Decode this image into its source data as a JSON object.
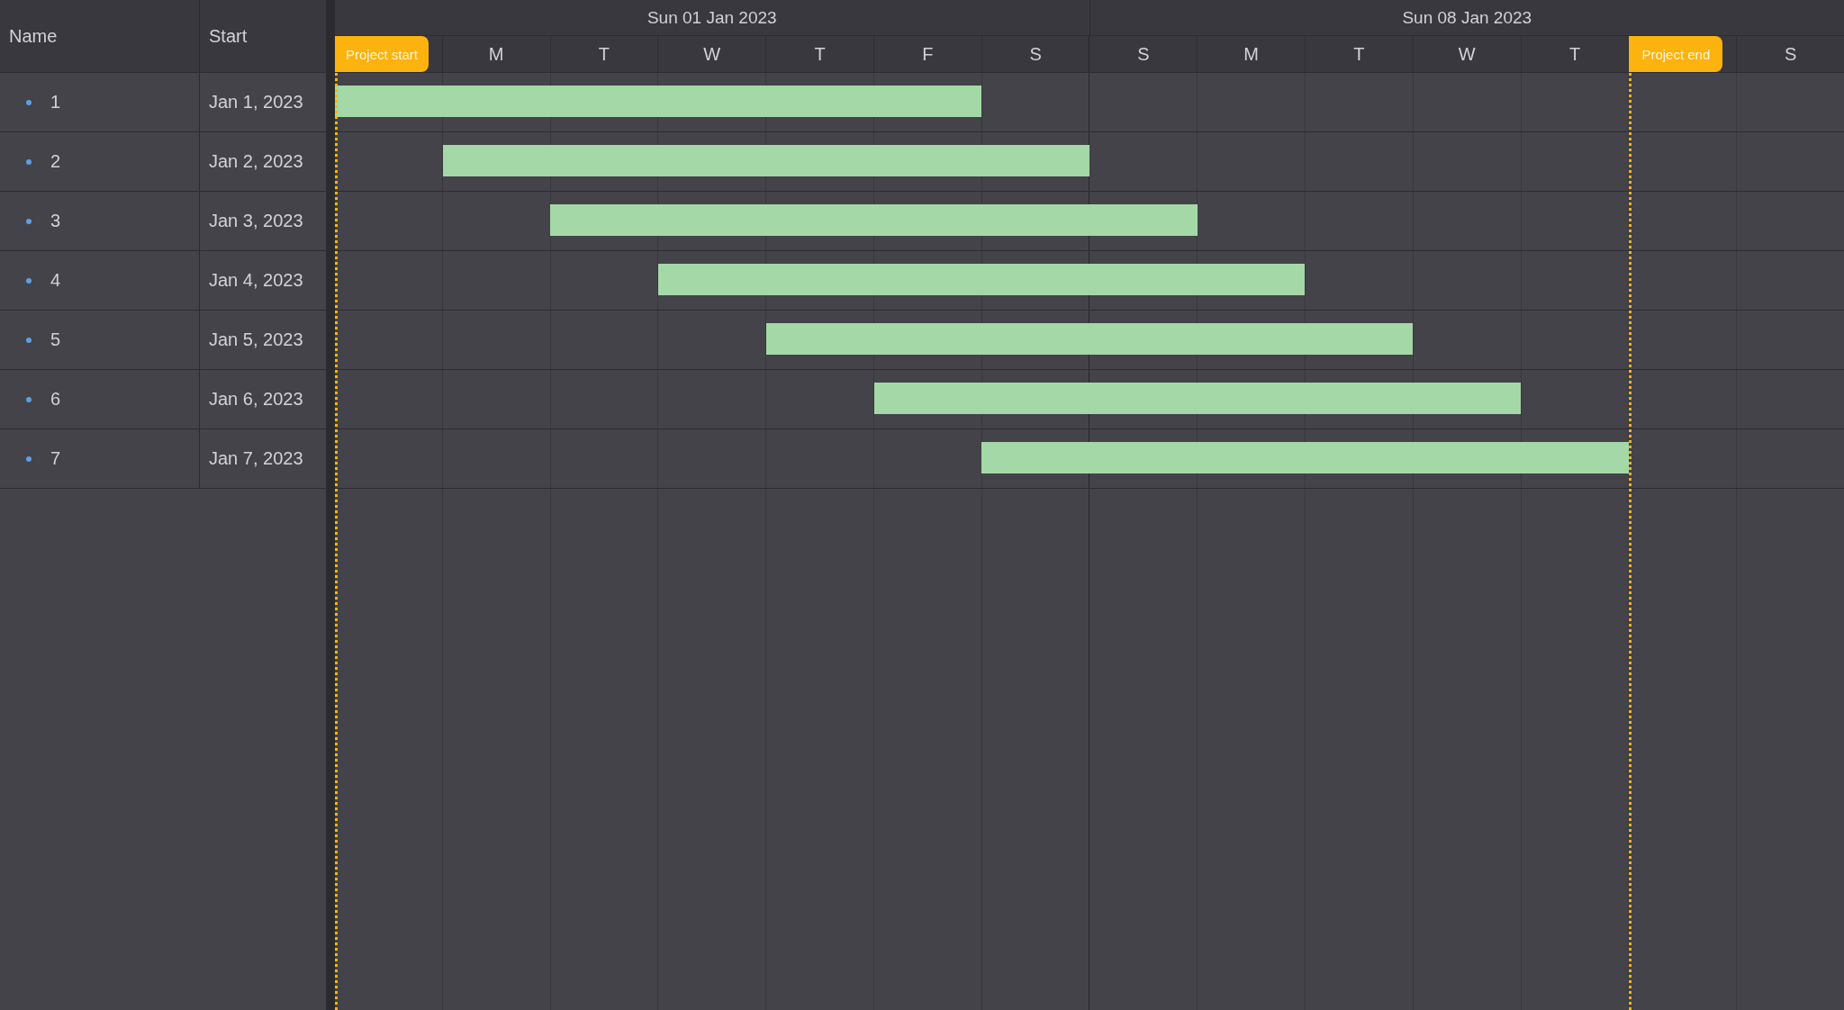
{
  "grid": {
    "columns": [
      "Name",
      "Start"
    ]
  },
  "tasks": [
    {
      "name": "1",
      "start": "Jan 1, 2023"
    },
    {
      "name": "2",
      "start": "Jan 2, 2023"
    },
    {
      "name": "3",
      "start": "Jan 3, 2023"
    },
    {
      "name": "4",
      "start": "Jan 4, 2023"
    },
    {
      "name": "5",
      "start": "Jan 5, 2023"
    },
    {
      "name": "6",
      "start": "Jan 6, 2023"
    },
    {
      "name": "7",
      "start": "Jan 7, 2023"
    }
  ],
  "timeline": {
    "weeks": [
      "Sun 01 Jan 2023",
      "Sun 08 Jan 2023"
    ],
    "columns": [
      {
        "marker": "Project start"
      },
      {
        "label": "M"
      },
      {
        "label": "T"
      },
      {
        "label": "W"
      },
      {
        "label": "T"
      },
      {
        "label": "F"
      },
      {
        "label": "S"
      },
      {
        "label": "S"
      },
      {
        "label": "M"
      },
      {
        "label": "T"
      },
      {
        "label": "W"
      },
      {
        "label": "T"
      },
      {
        "marker": "Project end"
      },
      {
        "label": "S"
      }
    ]
  }
}
